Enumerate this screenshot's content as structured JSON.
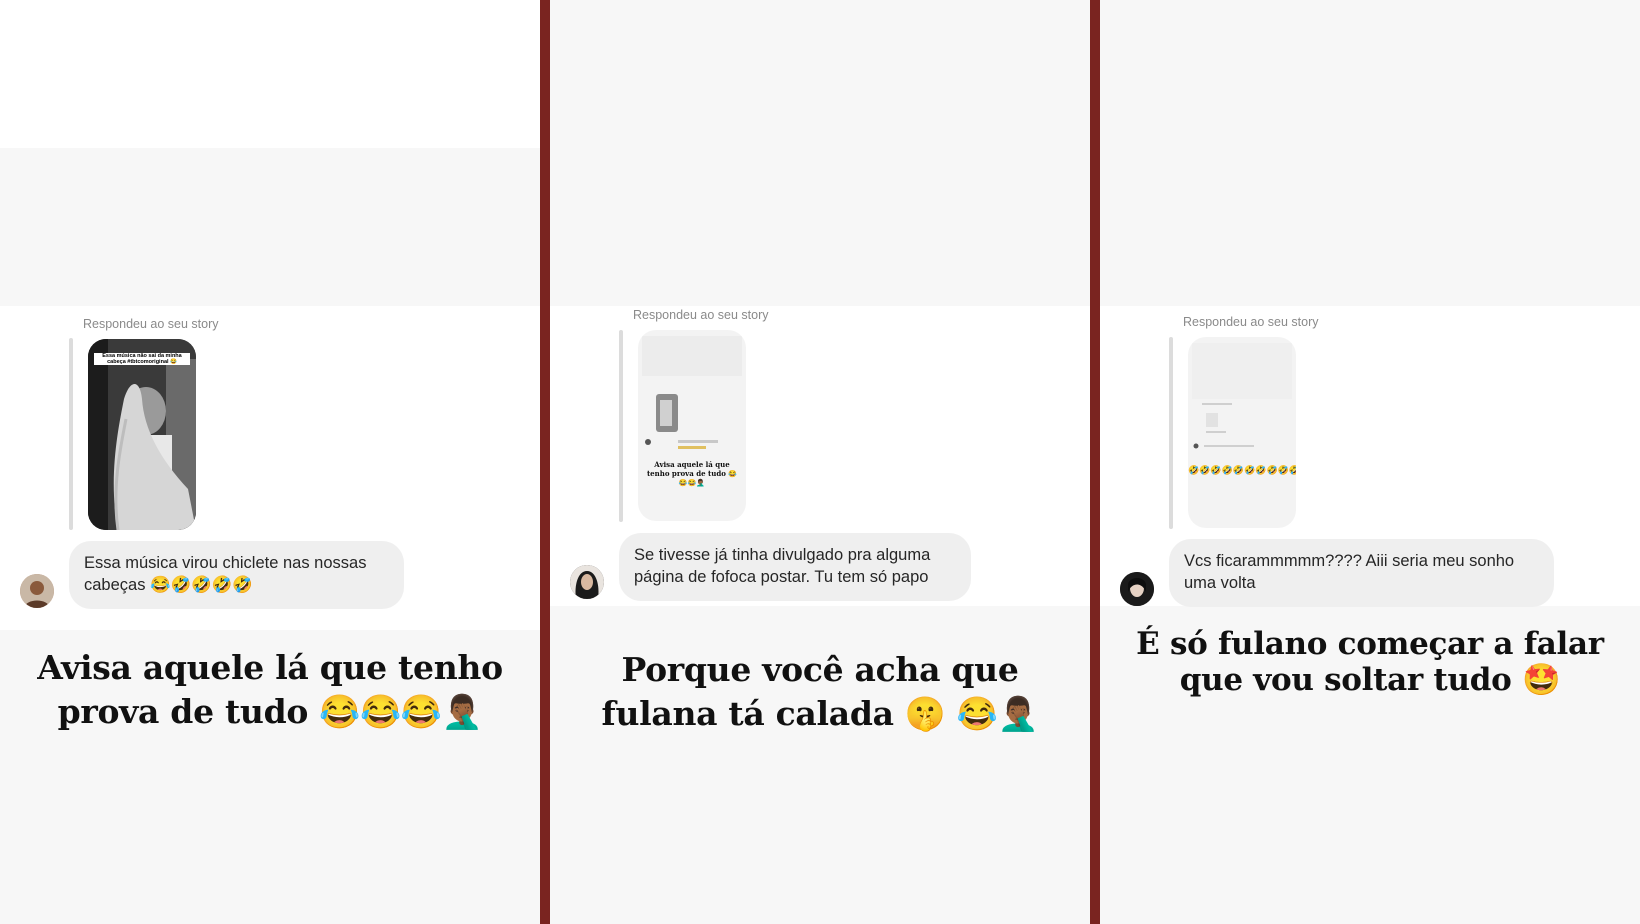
{
  "panels": [
    {
      "reply_label": "Respondeu ao seu story",
      "message": "Essa música virou chiclete nas nossas cabeças 😂🤣🤣🤣🤣",
      "caption": "Avisa aquele lá que tenho prova de tudo 😂😂😂🤦🏾‍♂️",
      "thumb_text": "Essa música não sai da minha cabeça #tbtcomoriginal 😂"
    },
    {
      "reply_label": "Respondeu ao seu story",
      "message": "Se tivesse já tinha divulgado pra alguma página de fofoca postar. Tu tem só papo",
      "caption": "Porque você acha que fulana tá calada 🤫 😂🤦🏾‍♂️",
      "thumb_text": "Avisa aquele lá que tenho prova de tudo 😂😂😂🤦🏾‍♂️"
    },
    {
      "reply_label": "Respondeu ao seu story",
      "message": "Vcs ficarammmmm???? Aiii seria meu sonho uma volta",
      "caption": "É só fulano começar a falar que vou soltar tudo 🤩",
      "thumb_text": "🤣🤣🤣🤣🤣🤣🤣🤣🤣🤣"
    }
  ]
}
